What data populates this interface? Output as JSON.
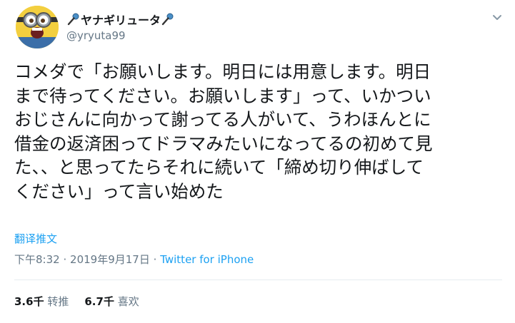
{
  "author": {
    "display_name": "ヤナギリュータ",
    "handle": "@yryuta99"
  },
  "icons": {
    "avatar": "minion-avatar",
    "name_decoration_left": "microphone-icon",
    "name_decoration_right": "microphone-icon",
    "menu": "chevron-down-icon"
  },
  "tweet": {
    "lines": [
      "コメダで「お願いします。明日には用意します。明日",
      "まで待ってください。お願いします」って、いかつい",
      "おじさんに向かって謝ってる人がいて、うわほんとに",
      "借金の返済困ってドラマみたいになってるの初めて見",
      "た、、と思ってたらそれに続いて「締め切り伸ばして",
      "ください」って言い始めた"
    ],
    "translate_label": "翻译推文",
    "time": "下午8:32",
    "separator": "·",
    "date": "2019年9月17日",
    "source": "Twitter for iPhone"
  },
  "stats": {
    "retweets_count": "3.6千",
    "retweets_label": "转推",
    "likes_count": "6.7千",
    "likes_label": "喜欢"
  },
  "colors": {
    "link": "#1da1f2",
    "secondary_text": "#657786",
    "primary_text": "#14171a",
    "divider": "#e6ecf0"
  }
}
